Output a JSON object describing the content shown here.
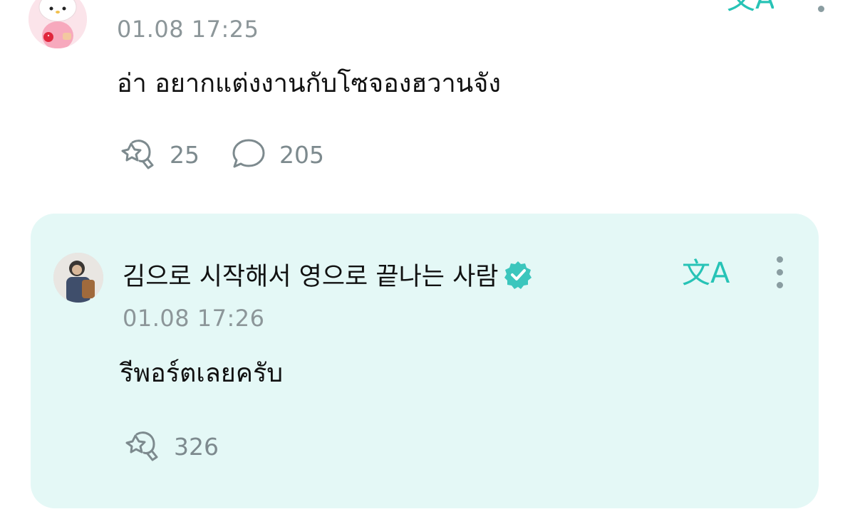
{
  "post": {
    "timestamp": "01.08 17:25",
    "text": "อ่า อยากแต่งงานกับโซจองฮวานจัง",
    "reaction_count": "25",
    "comment_count": "205"
  },
  "reply": {
    "username": "김으로 시작해서 영으로 끝나는 사람",
    "timestamp": "01.08 17:26",
    "text": "รีพอร์ตเลยครับ",
    "reaction_count": "326"
  },
  "colors": {
    "accent": "#27c3b6",
    "card_bg": "#e4f8f6",
    "muted": "#8c9699"
  },
  "icons": {
    "post_avatar": "hello-kitty-avatar",
    "translate": "translate-icon",
    "more": "more-vertical-icon",
    "reaction": "reaction-icon",
    "comment": "comment-icon",
    "verified": "verified-badge-icon"
  }
}
